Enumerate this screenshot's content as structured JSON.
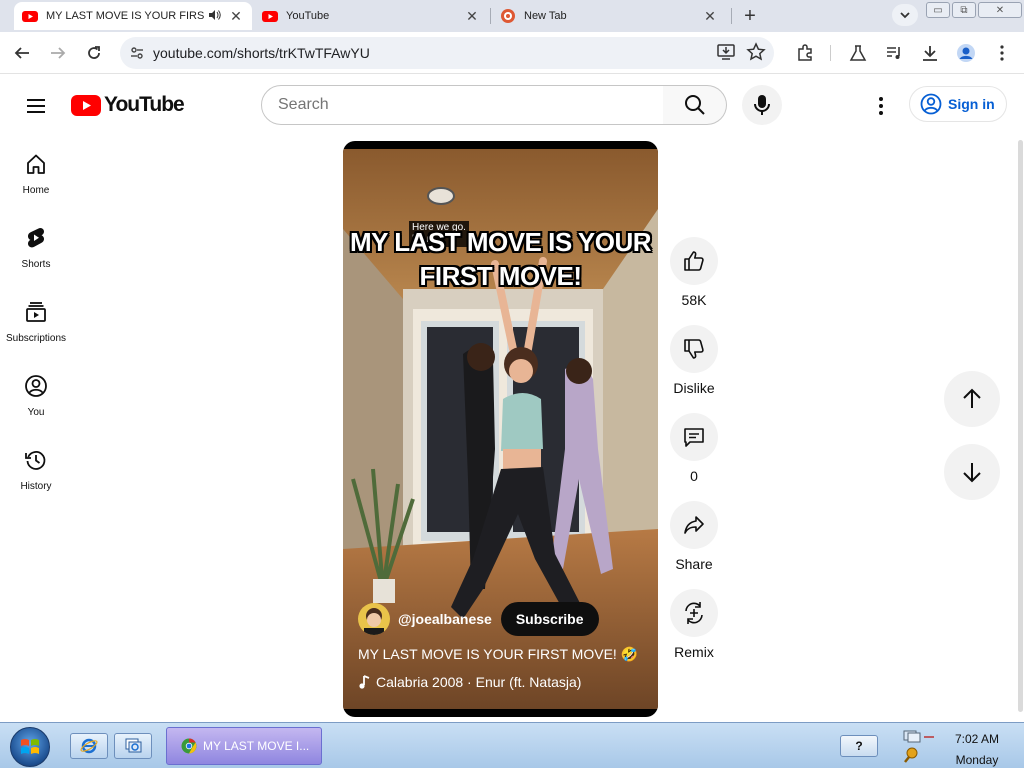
{
  "browser": {
    "tabs": [
      {
        "title": "MY LAST MOVE IS YOUR FIRST MOVE!",
        "active": true,
        "playing_audio": true
      },
      {
        "title": "YouTube",
        "active": false
      },
      {
        "title": "New Tab",
        "active": false
      }
    ],
    "url": "youtube.com/shorts/trKTwTFAwYU"
  },
  "masthead": {
    "brand": "YouTube",
    "search_placeholder": "Search",
    "signin_label": "Sign in"
  },
  "sidebar": {
    "items": [
      {
        "label": "Home",
        "icon": "home-icon"
      },
      {
        "label": "Shorts",
        "icon": "shorts-icon"
      },
      {
        "label": "Subscriptions",
        "icon": "subscriptions-icon"
      },
      {
        "label": "You",
        "icon": "you-icon"
      },
      {
        "label": "History",
        "icon": "history-icon"
      }
    ]
  },
  "short": {
    "caption": "Here we go.\n[Music]",
    "overlay_title": "MY LAST MOVE IS YOUR FIRST MOVE!",
    "channel": "@joealbanese",
    "subscribe_label": "Subscribe",
    "title": "MY LAST MOVE IS YOUR FIRST MOVE! 🤣",
    "music": "Calabria 2008 · Enur (ft. Natasja)"
  },
  "actions": {
    "like_count": "58K",
    "dislike_label": "Dislike",
    "comment_count": "0",
    "share_label": "Share",
    "remix_label": "Remix"
  },
  "taskbar": {
    "active_window": "MY LAST MOVE I...",
    "help_label": "?",
    "time": "7:02 AM",
    "day": "Monday"
  },
  "colors": {
    "youtube_red": "#ff0000",
    "link_blue": "#065fd4",
    "chip_gray": "#f2f2f2"
  }
}
